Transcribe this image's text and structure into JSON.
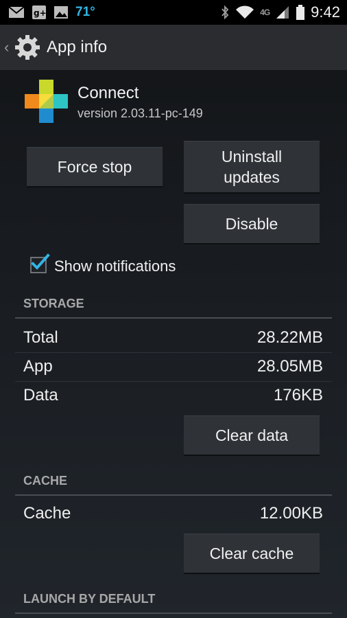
{
  "status_bar": {
    "icons": [
      "gmail-icon",
      "google-plus-icon",
      "gallery-icon"
    ],
    "temperature": "71°",
    "network": "4G",
    "time": "9:42"
  },
  "action_bar": {
    "title": "App info",
    "icon": "settings-gear-icon"
  },
  "app": {
    "name": "Connect",
    "version": "version 2.03.11-pc-149"
  },
  "buttons": {
    "force_stop": "Force stop",
    "uninstall_updates_line1": "Uninstall",
    "uninstall_updates_line2": "updates",
    "disable": "Disable",
    "clear_data": "Clear data",
    "clear_cache": "Clear cache"
  },
  "notifications": {
    "label": "Show notifications",
    "checked": true
  },
  "storage": {
    "header": "STORAGE",
    "rows": [
      {
        "label": "Total",
        "value": "28.22MB"
      },
      {
        "label": "App",
        "value": "28.05MB"
      },
      {
        "label": "Data",
        "value": "176KB"
      }
    ]
  },
  "cache": {
    "header": "CACHE",
    "rows": [
      {
        "label": "Cache",
        "value": "12.00KB"
      }
    ]
  },
  "launch_by_default": {
    "header": "LAUNCH BY DEFAULT"
  },
  "colors": {
    "accent": "#33b5e5",
    "background": "#1b1f24",
    "button": "#2f3338"
  }
}
